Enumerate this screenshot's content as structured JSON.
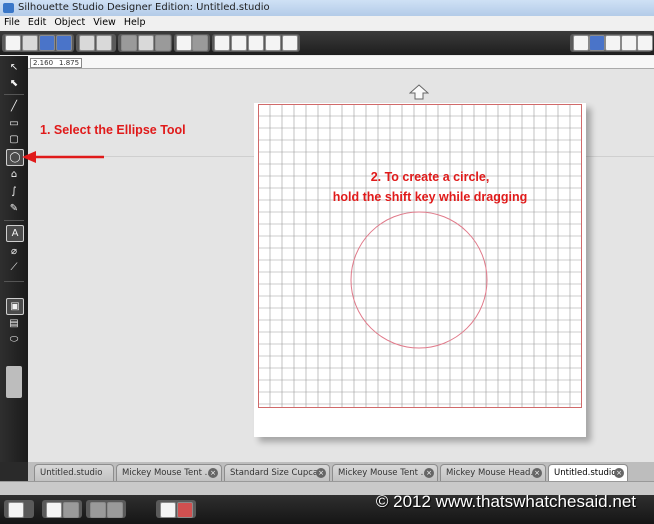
{
  "window": {
    "title": "Silhouette Studio Designer Edition: Untitled.studio"
  },
  "menu": {
    "items": [
      "File",
      "Edit",
      "Object",
      "View",
      "Help"
    ]
  },
  "ruler": {
    "readout_x": "2.160",
    "readout_y": "1.875"
  },
  "annotations": {
    "step1": "1. Select the Ellipse Tool",
    "step2_line1": "2.  To create a circle,",
    "step2_line2": "hold the shift key while dragging"
  },
  "tabs": [
    {
      "label": "Untitled.studio",
      "active": false
    },
    {
      "label": "Mickey Mouse Tent ...",
      "active": false
    },
    {
      "label": "Standard Size Cupca...",
      "active": false
    },
    {
      "label": "Mickey Mouse Tent ...",
      "active": false
    },
    {
      "label": "Mickey Mouse Head...",
      "active": false
    },
    {
      "label": "Untitled.studio",
      "active": true
    }
  ],
  "watermark": "© 2012 www.thatswhatchesaid.net",
  "colors": {
    "annotation": "#e01a1a",
    "grid": "#9a9a9a",
    "cut_border": "#d06a6a",
    "circle": "#e07a8a"
  },
  "icons": {
    "toolbar": [
      "new-file-icon",
      "open-file-icon",
      "save-icon",
      "save-to-library-icon",
      "print-icon",
      "send-to-cutter-icon",
      "cut-icon",
      "copy-icon",
      "paste-icon",
      "undo-icon",
      "redo-icon",
      "zoom-in-icon",
      "zoom-out-icon",
      "zoom-select-icon",
      "pan-icon",
      "fit-page-icon"
    ],
    "tools": [
      "select-icon",
      "point-edit-icon",
      "line-icon",
      "rectangle-icon",
      "rounded-rectangle-icon",
      "ellipse-icon",
      "polygon-icon",
      "curve-icon",
      "freehand-icon",
      "text-icon",
      "eraser-icon",
      "knife-icon",
      "fill-icon",
      "replicate-icon",
      "cut-settings-icon",
      "scroll-icon"
    ]
  }
}
